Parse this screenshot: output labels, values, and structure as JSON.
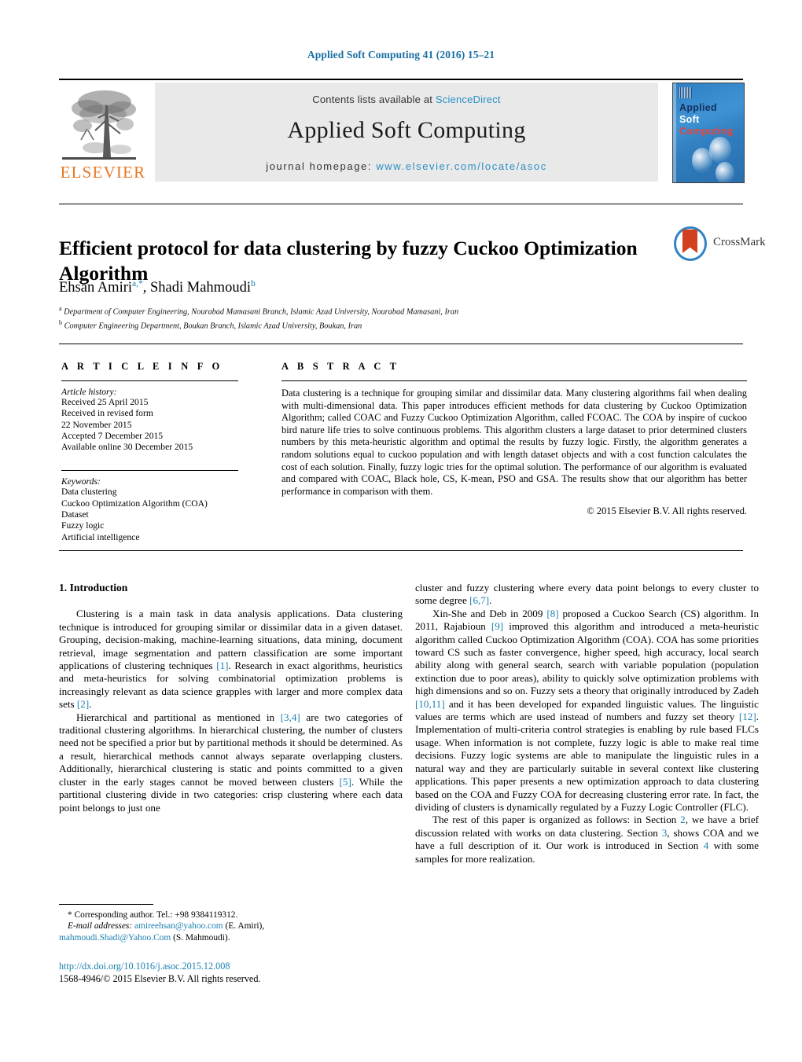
{
  "running_head": "Applied Soft Computing 41 (2016) 15–21",
  "masthead": {
    "contents_prefix": "Contents lists available at ",
    "sciencedirect": "ScienceDirect",
    "journal_title": "Applied Soft Computing",
    "homepage_prefix": "journal homepage: ",
    "homepage_url": "www.elsevier.com/locate/asoc",
    "publisher": "ELSEVIER",
    "cover": {
      "line1": "Applied",
      "line2": "Soft",
      "line3": "Computing"
    },
    "colors": {
      "link": "#2a8fc4",
      "elsevier_orange": "#e87722",
      "cover_blue": "#2e7fc4",
      "cover_red": "#e8453c"
    }
  },
  "article": {
    "title": "Efficient protocol for data clustering by fuzzy Cuckoo Optimization Algorithm",
    "crossmark_label": "CrossMark",
    "authors": "Ehsan Amiri",
    "author1_sup": "a,*",
    "authors_second": ", Shadi Mahmoudi",
    "author2_sup": "b",
    "affiliation_a": "Department of Computer Engineering, Nourabad Mamasani Branch, Islamic Azad University, Nourabad Mamasani, Iran",
    "affiliation_b": "Computer Engineering Department, Boukan Branch, Islamic Azad University, Boukan, Iran"
  },
  "info": {
    "heading": "A R T I C L E    I N F O",
    "history_label": "Article history:",
    "history": [
      "Received 25 April 2015",
      "Received in revised form",
      "22 November 2015",
      "Accepted 7 December 2015",
      "Available online 30 December 2015"
    ],
    "keywords_label": "Keywords:",
    "keywords": [
      "Data clustering",
      "Cuckoo Optimization Algorithm (COA)",
      "Dataset",
      "Fuzzy logic",
      "Artificial intelligence"
    ]
  },
  "abstract": {
    "heading": "A B S T R A C T",
    "body": "Data clustering is a technique for grouping similar and dissimilar data. Many clustering algorithms fail when dealing with multi-dimensional data. This paper introduces efficient methods for data clustering by Cuckoo Optimization Algorithm; called COAC and Fuzzy Cuckoo Optimization Algorithm, called FCOAC. The COA by inspire of cuckoo bird nature life tries to solve continuous problems. This algorithm clusters a large dataset to prior determined clusters numbers by this meta-heuristic algorithm and optimal the results by fuzzy logic. Firstly, the algorithm generates a random solutions equal to cuckoo population and with length dataset objects and with a cost function calculates the cost of each solution. Finally, fuzzy logic tries for the optimal solution. The performance of our algorithm is evaluated and compared with COAC, Black hole, CS, K-mean, PSO and GSA. The results show that our algorithm has better performance in comparison with them.",
    "copyright": "© 2015 Elsevier B.V. All rights reserved."
  },
  "body": {
    "section_heading": "1.  Introduction",
    "left_paragraphs": [
      "Clustering is a main task in data analysis applications. Data clustering technique is introduced for grouping similar or dissimilar data in a given dataset. Grouping, decision-making, machine-learning situations, data mining, document retrieval, image segmentation and pattern classification are some important applications of clustering techniques [1]. Research in exact algorithms, heuristics and meta-heuristics for solving combinatorial optimization problems is increasingly relevant as data science grapples with larger and more complex data sets [2].",
      "Hierarchical and partitional as mentioned in [3,4] are two categories of traditional clustering algorithms. In hierarchical clustering, the number of clusters need not be specified a prior but by partitional methods it should be determined. As a result, hierarchical methods cannot always separate overlapping clusters. Additionally, hierarchical clustering is static and points committed to a given cluster in the early stages cannot be moved between clusters [5]. While the partitional clustering divide in two categories: crisp clustering where each data point belongs to just one"
    ],
    "right_paragraphs": [
      "cluster and fuzzy clustering where every data point belongs to every cluster to some degree [6,7].",
      "Xin-She and Deb in 2009 [8] proposed a Cuckoo Search (CS) algorithm. In 2011, Rajabioun [9] improved this algorithm and introduced a meta-heuristic algorithm called Cuckoo Optimization Algorithm (COA). COA has some priorities toward CS such as faster convergence, higher speed, high accuracy, local search ability along with general search, search with variable population (population extinction due to poor areas), ability to quickly solve optimization problems with high dimensions and so on. Fuzzy sets a theory that originally introduced by Zadeh [10,11] and it has been developed for expanded linguistic values. The linguistic values are terms which are used instead of numbers and fuzzy set theory [12]. Implementation of multi-criteria control strategies is enabling by rule based FLCs usage. When information is not complete, fuzzy logic is able to make real time decisions. Fuzzy logic systems are able to manipulate the linguistic rules in a natural way and they are particularly suitable in several context like clustering applications. This paper presents a new optimization approach to data clustering based on the COA and Fuzzy COA for decreasing clustering error rate. In fact, the dividing of clusters is dynamically regulated by a Fuzzy Logic Controller (FLC).",
      "The rest of this paper is organized as follows: in Section 2, we have a brief discussion related with works on data clustering. Section 3, shows COA and we have a full description of it. Our work is introduced in Section 4 with some samples for more realization."
    ]
  },
  "footer": {
    "corresponding": "* Corresponding author. Tel.: +98 9384119312.",
    "email_label": "E-mail addresses:",
    "email1": "amireehsan@yahoo.com",
    "email1_owner": " (E. Amiri),",
    "email2": "mahmoudi.Shadi@Yahoo.Com",
    "email2_owner": " (S. Mahmoudi).",
    "doi": "http://dx.doi.org/10.1016/j.asoc.2015.12.008",
    "issn_line": "1568-4946/© 2015 Elsevier B.V. All rights reserved."
  }
}
